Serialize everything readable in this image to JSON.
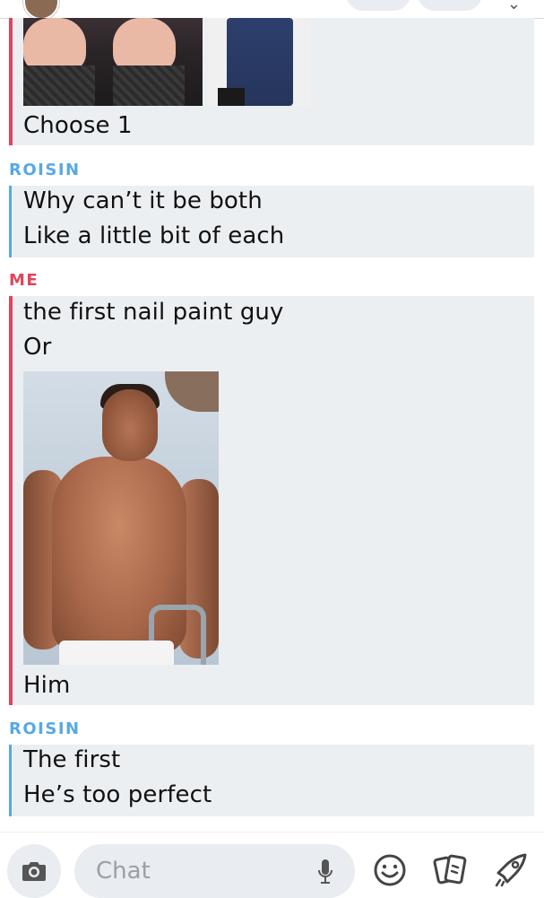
{
  "messages": [
    {
      "sender": "",
      "lines": [
        "Choose 1"
      ],
      "has_images": true
    },
    {
      "sender": "ROISIN",
      "lines": [
        "Why can’t it be both",
        "Like a little bit of each"
      ]
    },
    {
      "sender": "ME",
      "lines": [
        "the first nail paint guy",
        "Or",
        "Him"
      ],
      "has_images": true
    },
    {
      "sender": "ROISIN",
      "lines": [
        "The first",
        "He’s too perfect"
      ]
    }
  ],
  "chat_bar": {
    "placeholder": "Chat",
    "icons": [
      "camera-icon",
      "microphone-icon",
      "emoji-icon",
      "cards-icon",
      "rocket-icon"
    ]
  },
  "colors": {
    "me": "#e0455d",
    "other": "#58a8e6",
    "bubble_bg": "#eceff2"
  }
}
